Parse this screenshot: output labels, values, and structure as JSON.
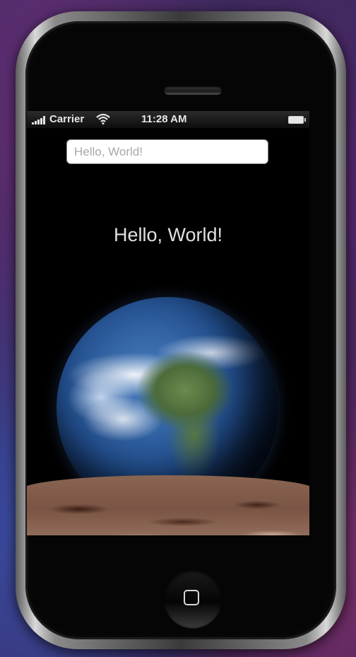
{
  "status_bar": {
    "carrier": "Carrier",
    "time": "11:28 AM",
    "signal_icon": "signal-bars-icon",
    "wifi_icon": "wifi-icon",
    "battery_icon": "battery-icon"
  },
  "app": {
    "text_field": {
      "value": "",
      "placeholder": "Hello, World!"
    },
    "greeting_label": "Hello, World!",
    "earth_image": "earth-image",
    "moon_image": "moon-surface-image"
  },
  "hardware": {
    "home_button_icon": "home-button-icon",
    "earpiece": "earpiece-slot"
  }
}
